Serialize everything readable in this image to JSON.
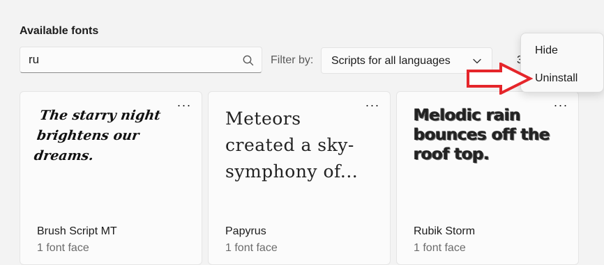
{
  "section": {
    "title": "Available fonts"
  },
  "search": {
    "value": "ru",
    "icon": "search-icon"
  },
  "filter": {
    "label": "Filter by:",
    "selected": "Scripts for all languages",
    "icon": "chevron-down-icon"
  },
  "count": {
    "text": "3"
  },
  "cards": [
    {
      "preview_text": "The starry night brightens our dreams.",
      "font_name": "Brush Script MT",
      "faces": "1 font face",
      "more_label": "···"
    },
    {
      "preview_text": "Meteors created a sky-symphony of...",
      "font_name": "Papyrus",
      "faces": "1 font face",
      "more_label": "···"
    },
    {
      "preview_text": "Melodic rain bounces off the roof top.",
      "font_name": "Rubik Storm",
      "faces": "1 font face",
      "more_label": "···"
    }
  ],
  "context_menu": {
    "items": [
      {
        "label": "Hide"
      },
      {
        "label": "Uninstall"
      }
    ]
  },
  "annotation": {
    "arrow_color": "#e5262b",
    "arrow_fill": "#ffffff"
  }
}
